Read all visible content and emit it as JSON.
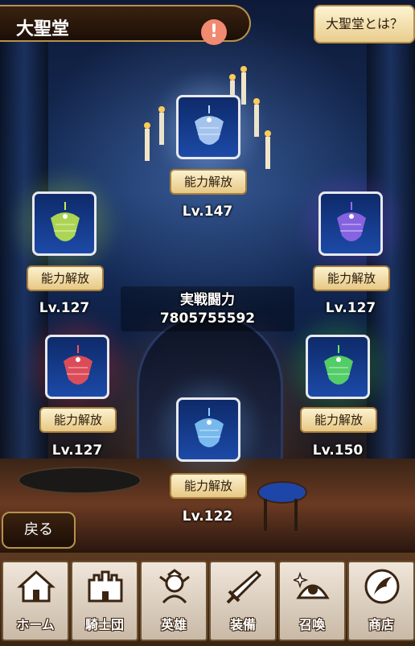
{
  "header": {
    "title": "大聖堂",
    "alert_symbol": "!",
    "about_label": "大聖堂とは？"
  },
  "slots": [
    {
      "id": "top",
      "level": "Lv.147",
      "button": "能力解放",
      "color": "#9ec6ff",
      "crystal": "#bcdcff"
    },
    {
      "id": "left-upper",
      "level": "Lv.127",
      "button": "能力解放",
      "color": "#a6d23a",
      "crystal": "#c8f04a"
    },
    {
      "id": "right-upper",
      "level": "Lv.127",
      "button": "能力解放",
      "color": "#7a46d8",
      "crystal": "#9a6af0"
    },
    {
      "id": "left-lower",
      "level": "Lv.127",
      "button": "能力解放",
      "color": "#d83030",
      "crystal": "#ff5050"
    },
    {
      "id": "right-lower",
      "level": "Lv.150",
      "button": "能力解放",
      "color": "#3cc040",
      "crystal": "#5ee860"
    },
    {
      "id": "bottom",
      "level": "Lv.122",
      "button": "能力解放",
      "color": "#5aa0e8",
      "crystal": "#8ad0ff"
    }
  ],
  "power": {
    "label": "実戦闘力",
    "value": "7805755592"
  },
  "back_label": "戻る",
  "nav": [
    {
      "label": "ホーム",
      "icon": "home-icon"
    },
    {
      "label": "騎士団",
      "icon": "castle-icon"
    },
    {
      "label": "英雄",
      "icon": "hero-icon"
    },
    {
      "label": "装備",
      "icon": "sword-icon"
    },
    {
      "label": "召喚",
      "icon": "summon-icon"
    },
    {
      "label": "商店",
      "icon": "shop-icon"
    }
  ],
  "colors": {
    "gold_border": "#b8924a",
    "button_fill": "#fbf2cf",
    "dark_brown": "#3a2210"
  }
}
